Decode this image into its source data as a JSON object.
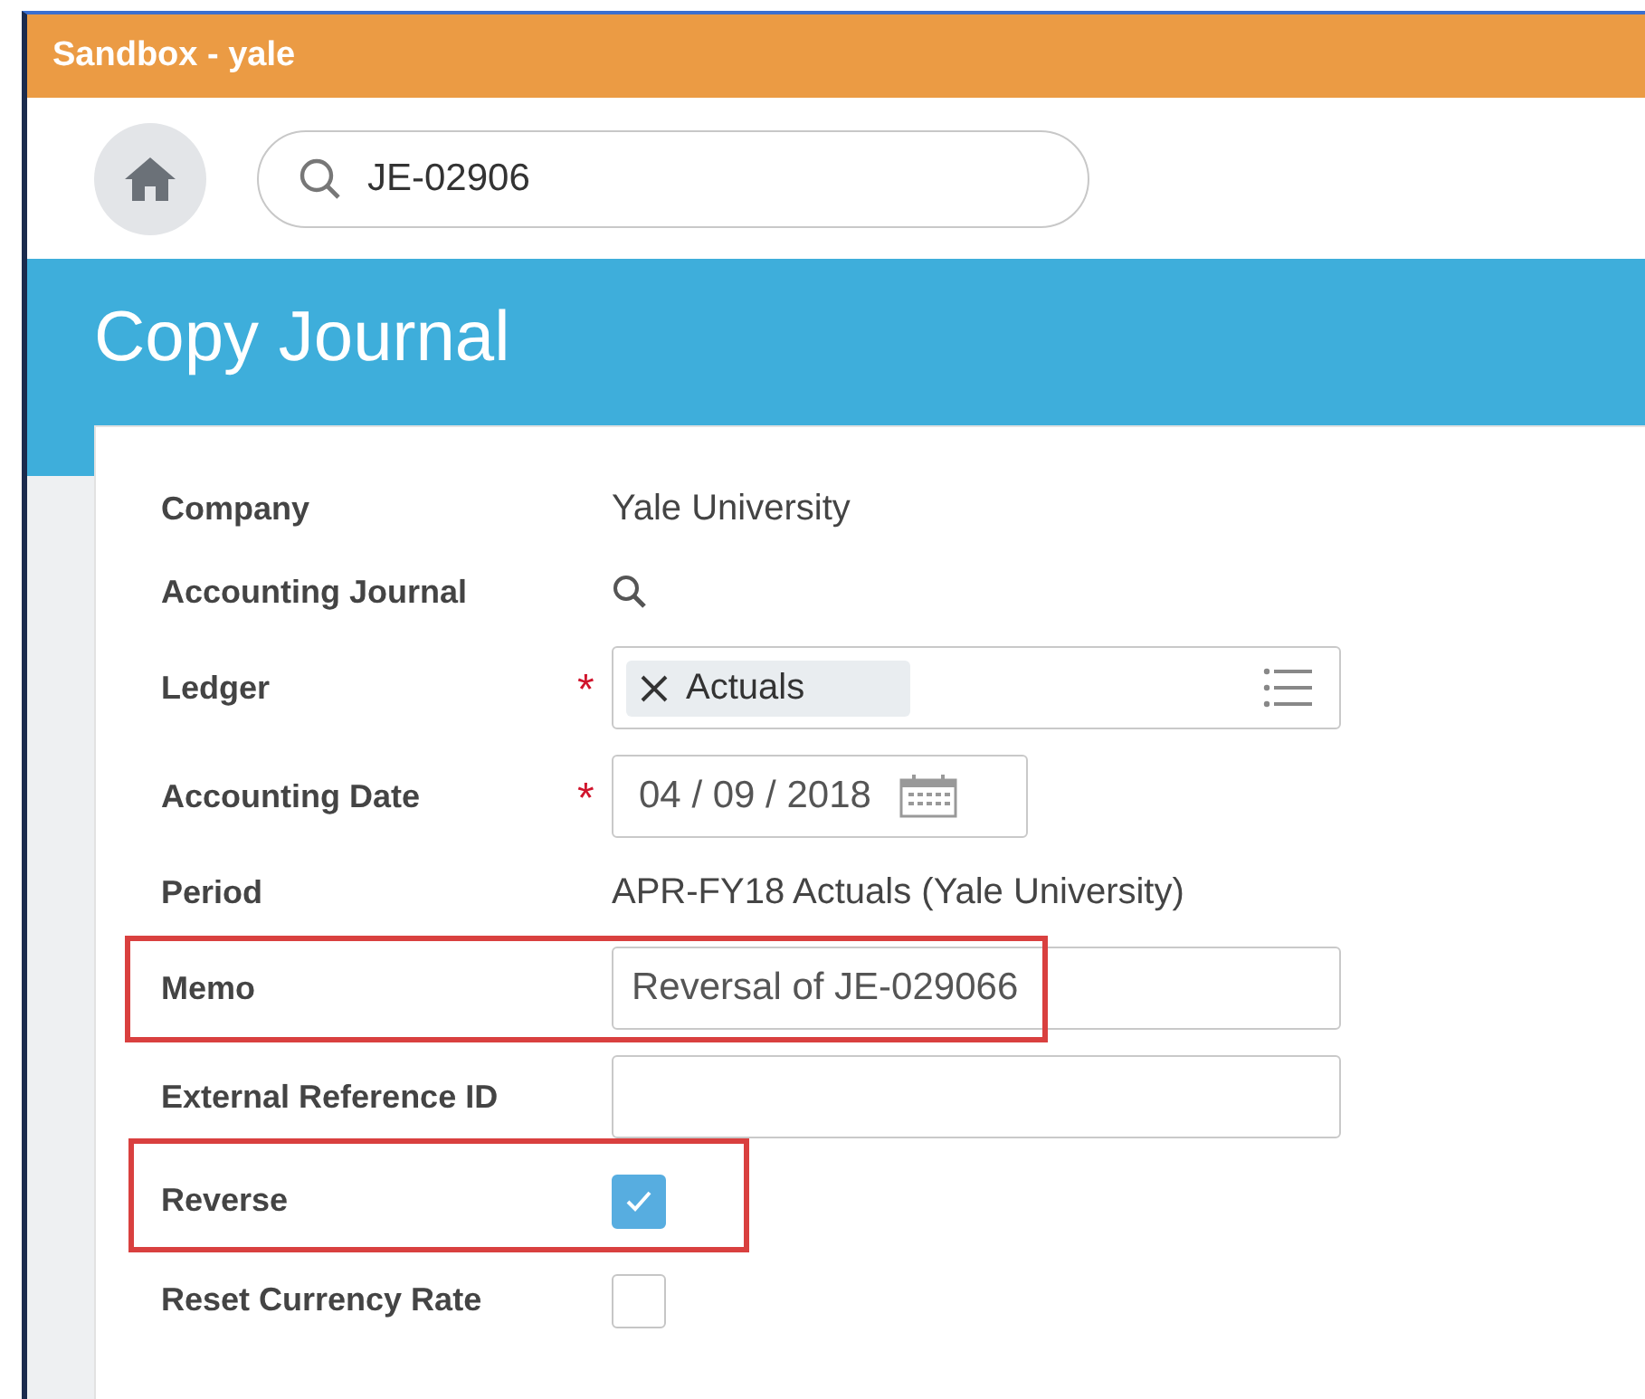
{
  "tenant_bar": {
    "title": "Sandbox - yale"
  },
  "search": {
    "value": "JE-02906"
  },
  "page": {
    "title": "Copy Journal"
  },
  "fields": [
    {
      "kind": "text",
      "label": "Company",
      "highlighted": false,
      "value": "Yale University"
    },
    {
      "kind": "lookup",
      "label": "Accounting Journal",
      "highlighted": false
    },
    {
      "kind": "multiselect",
      "label": "Ledger",
      "highlighted": false,
      "value": "Actuals",
      "marker": "*"
    },
    {
      "kind": "date",
      "label": "Accounting Date",
      "highlighted": false,
      "value": "04 / 09 / 2018",
      "marker": "*"
    },
    {
      "kind": "text",
      "label": "Period",
      "highlighted": false,
      "value": "APR-FY18 Actuals (Yale University)"
    },
    {
      "kind": "input",
      "label": "Memo",
      "highlighted": true,
      "value": "Reversal of JE-029066"
    },
    {
      "kind": "input",
      "label": "External Reference ID",
      "highlighted": false
    },
    {
      "kind": "checkbox",
      "label": "Reverse",
      "highlighted": true,
      "checked": true
    },
    {
      "kind": "checkbox",
      "label": "Reset Currency Rate",
      "highlighted": false,
      "checked": false
    }
  ]
}
